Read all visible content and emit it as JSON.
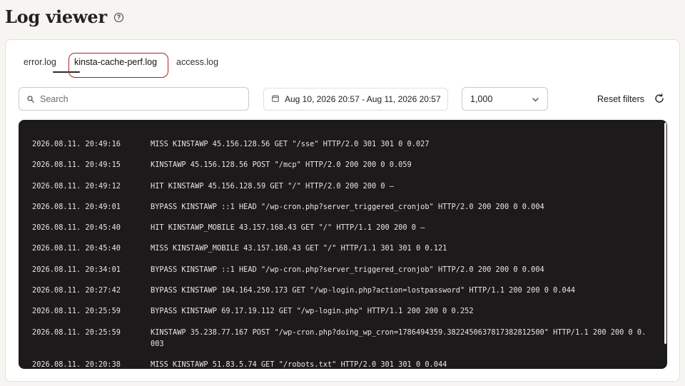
{
  "page": {
    "title": "Log viewer"
  },
  "tabs": [
    {
      "label": "error.log"
    },
    {
      "label": "kinsta-cache-perf.log"
    },
    {
      "label": "access.log"
    }
  ],
  "filters": {
    "search_placeholder": "Search",
    "date_range": "Aug 10, 2026 20:57 - Aug 11, 2026 20:57",
    "limit": "1,000",
    "reset_label": "Reset filters"
  },
  "logs": [
    {
      "time": "2026.08.11. 20:49:16",
      "message": "MISS KINSTAWP 45.156.128.56 GET \"/sse\" HTTP/2.0 301 301 0 0.027"
    },
    {
      "time": "2026.08.11. 20:49:15",
      "message": "KINSTAWP 45.156.128.56 POST \"/mcp\" HTTP/2.0 200 200 0 0.059"
    },
    {
      "time": "2026.08.11. 20:49:12",
      "message": "HIT KINSTAWP 45.156.128.59 GET \"/\" HTTP/2.0 200 200 0 –"
    },
    {
      "time": "2026.08.11. 20:49:01",
      "message": "BYPASS KINSTAWP ::1 HEAD \"/wp-cron.php?server_triggered_cronjob\" HTTP/2.0 200 200 0 0.004"
    },
    {
      "time": "2026.08.11. 20:45:40",
      "message": "HIT KINSTAWP_MOBILE 43.157.168.43 GET \"/\" HTTP/1.1 200 200 0 –"
    },
    {
      "time": "2026.08.11. 20:45:40",
      "message": "MISS KINSTAWP_MOBILE 43.157.168.43 GET \"/\" HTTP/1.1 301 301 0 0.121"
    },
    {
      "time": "2026.08.11. 20:34:01",
      "message": "BYPASS KINSTAWP ::1 HEAD \"/wp-cron.php?server_triggered_cronjob\" HTTP/2.0 200 200 0 0.004"
    },
    {
      "time": "2026.08.11. 20:27:42",
      "message": "BYPASS KINSTAWP 104.164.250.173 GET \"/wp-login.php?action=lostpassword\" HTTP/1.1 200 200 0 0.044"
    },
    {
      "time": "2026.08.11. 20:25:59",
      "message": "BYPASS KINSTAWP 69.17.19.112 GET \"/wp-login.php\" HTTP/1.1 200 200 0 0.252"
    },
    {
      "time": "2026.08.11. 20:25:59",
      "message": "KINSTAWP 35.238.77.167 POST \"/wp-cron.php?doing_wp_cron=1786494359.3822450637817382812500\" HTTP/1.1 200 200 0 0.003"
    },
    {
      "time": "2026.08.11. 20:20:38",
      "message": "MISS KINSTAWP 51.83.5.74 GET \"/robots.txt\" HTTP/2.0 301 301 0 0.044"
    }
  ]
}
